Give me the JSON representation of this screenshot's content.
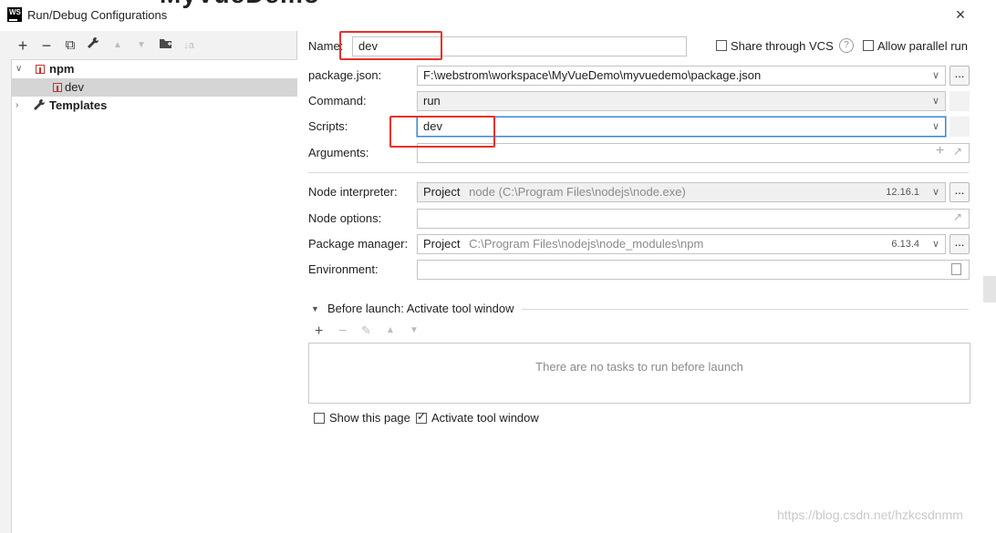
{
  "window": {
    "logo": "WS",
    "title": "Run/Debug Configurations",
    "close_icon": "×",
    "background_title_fragment": "MyVueDemo"
  },
  "left_toolbar": {
    "add_icon": "+",
    "remove_icon": "−",
    "copy_icon": "⧉",
    "settings_icon": "🔧",
    "up_icon": "▲",
    "down_icon": "▼",
    "folder_icon": "📁",
    "sort_icon": "↓a"
  },
  "tree": {
    "items": [
      {
        "label": "npm",
        "expanded": true
      },
      {
        "label": "dev",
        "selected": true
      },
      {
        "label": "Templates",
        "expanded": false
      }
    ]
  },
  "form": {
    "name_label": "Name:",
    "name_value": "dev",
    "share_vcs_label": "Share through VCS",
    "share_vcs_checked": false,
    "help_icon": "?",
    "allow_parallel_label": "Allow parallel run",
    "allow_parallel_checked": false,
    "package_json_label": "package.json:",
    "package_json_value": "F:\\webstrom\\workspace\\MyVueDemo\\myvuedemo\\package.json",
    "command_label": "Command:",
    "command_value": "run",
    "scripts_label": "Scripts:",
    "scripts_value": "dev",
    "arguments_label": "Arguments:",
    "arguments_value": "",
    "node_interpreter_label": "Node interpreter:",
    "node_interpreter_project": "Project",
    "node_interpreter_path": "node (C:\\Program Files\\nodejs\\node.exe)",
    "node_interpreter_version": "12.16.1",
    "node_options_label": "Node options:",
    "node_options_value": "",
    "package_manager_label": "Package manager:",
    "package_manager_project": "Project",
    "package_manager_path": "C:\\Program Files\\nodejs\\node_modules\\npm",
    "package_manager_version": "6.13.4",
    "environment_label": "Environment:",
    "environment_value": "",
    "browse_label": "..."
  },
  "before_launch": {
    "title": "Before launch: Activate tool window",
    "empty_text": "There are no tasks to run before launch",
    "show_page_label": "Show this page",
    "show_page_checked": false,
    "activate_tool_label": "Activate tool window",
    "activate_tool_checked": true
  },
  "watermark": "https://blog.csdn.net/hzkcsdnmm",
  "colors": {
    "highlight_box": "#e8302a",
    "focus_border": "#3b84d6",
    "selection": "#d5d5d5"
  }
}
